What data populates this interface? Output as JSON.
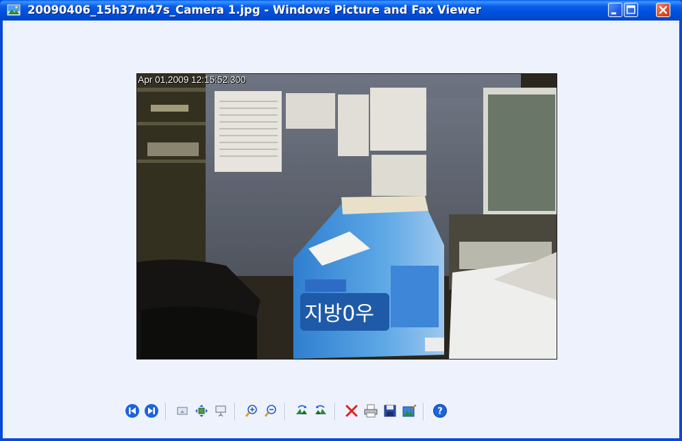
{
  "window": {
    "title": "20090406_15h37m47s_Camera 1.jpg - Windows Picture and Fax Viewer"
  },
  "image": {
    "timestamp": "Apr 01,2009 12:15:52.300"
  },
  "toolbar": {
    "buttons": [
      {
        "name": "previous-image",
        "icon": "previous-icon"
      },
      {
        "name": "next-image",
        "icon": "next-icon"
      },
      {
        "name": "best-fit",
        "icon": "best-fit-icon"
      },
      {
        "name": "actual-size",
        "icon": "actual-size-icon"
      },
      {
        "name": "slide-show",
        "icon": "slideshow-icon"
      },
      {
        "name": "zoom-in",
        "icon": "zoom-in-icon"
      },
      {
        "name": "zoom-out",
        "icon": "zoom-out-icon"
      },
      {
        "name": "rotate-clockwise",
        "icon": "rotate-clockwise-icon"
      },
      {
        "name": "rotate-counterclockwise",
        "icon": "rotate-counterclockwise-icon"
      },
      {
        "name": "delete",
        "icon": "delete-icon"
      },
      {
        "name": "print",
        "icon": "print-icon"
      },
      {
        "name": "copy-to",
        "icon": "save-icon"
      },
      {
        "name": "open-for-editing",
        "icon": "edit-icon"
      },
      {
        "name": "help",
        "icon": "help-icon"
      }
    ]
  },
  "colors": {
    "titlebar": "#0a5ee8",
    "client_background": "#eef2fc",
    "close_button": "#e0502c"
  }
}
